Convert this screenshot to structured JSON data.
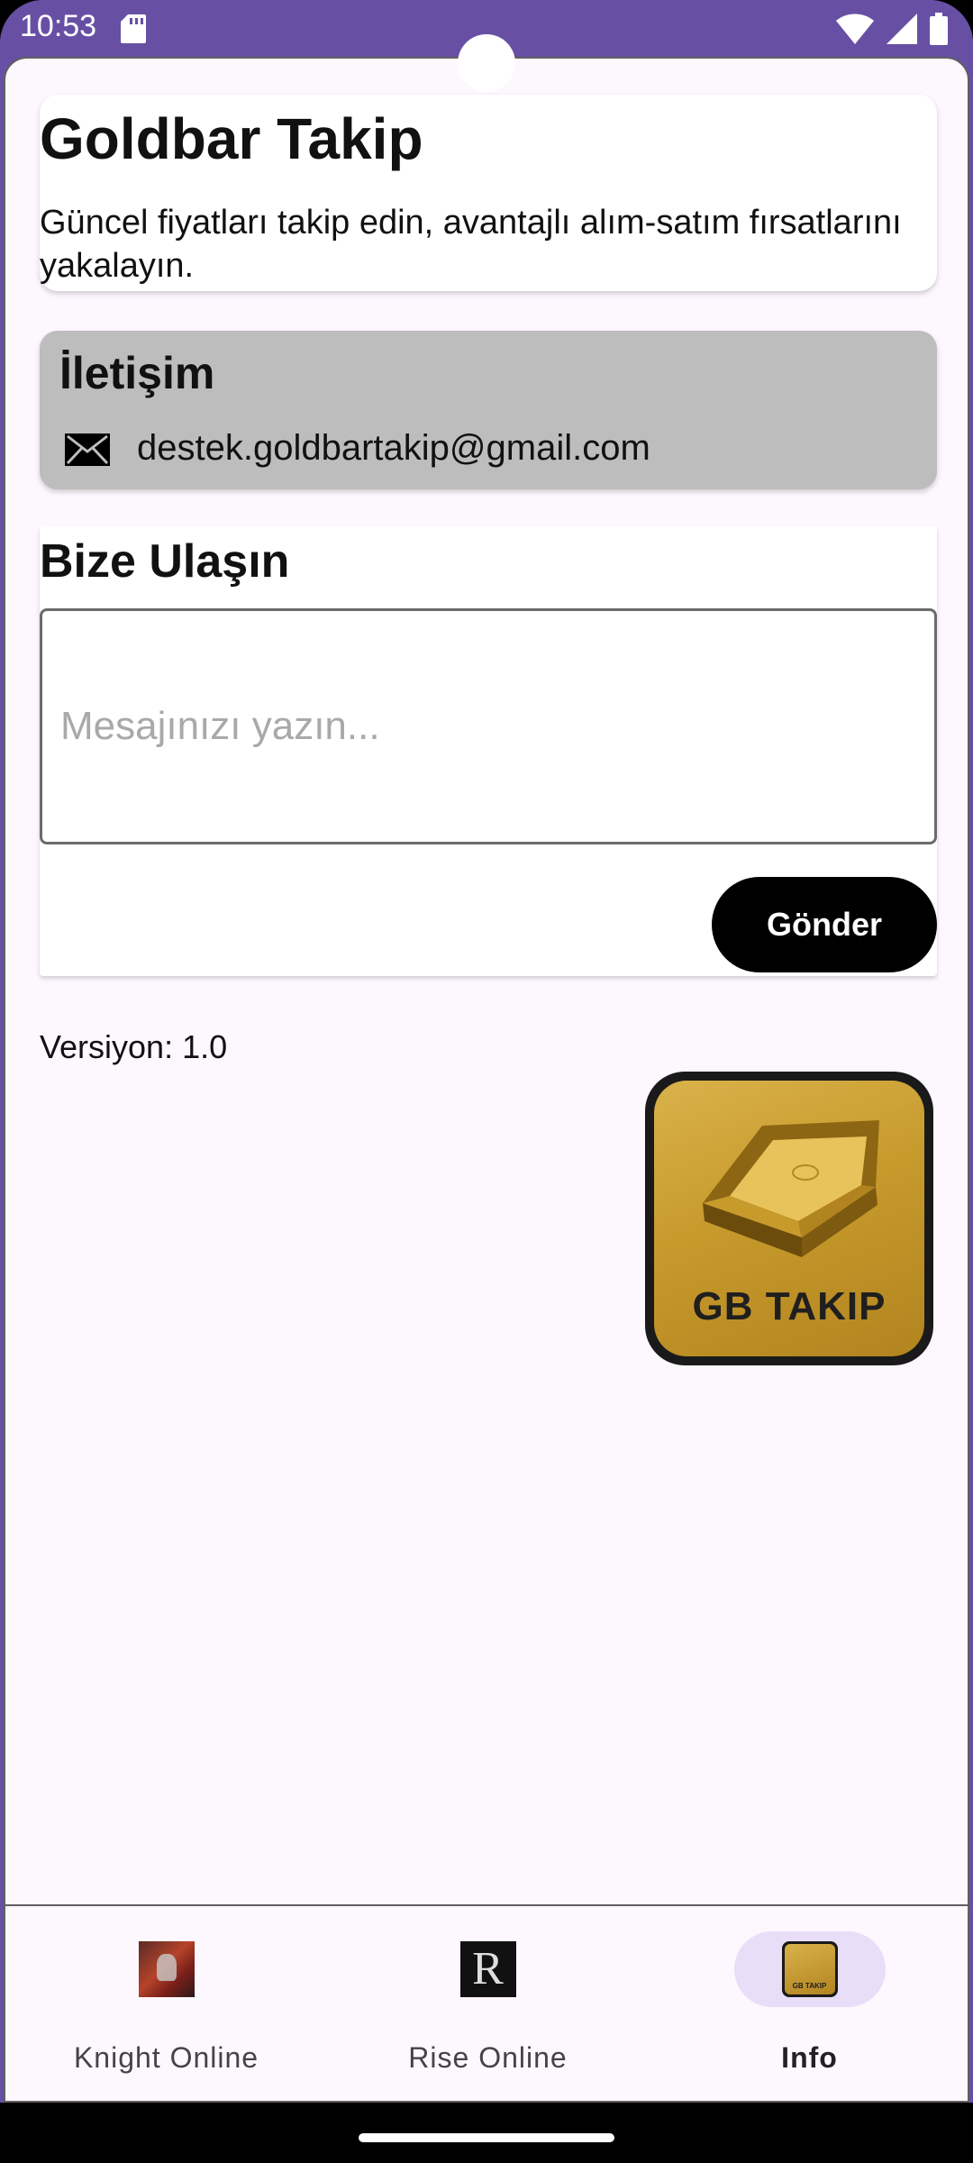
{
  "status_bar": {
    "time": "10:53",
    "icons": [
      "sd-card-icon",
      "wifi-icon",
      "signal-icon",
      "battery-icon"
    ]
  },
  "header": {
    "title": "Goldbar Takip",
    "subtitle": "Güncel fiyatları takip edin, avantajlı alım-satım fırsatlarını yakalayın."
  },
  "contact": {
    "title": "İletişim",
    "icon": "mail-icon",
    "email": "destek.goldbartakip@gmail.com"
  },
  "form": {
    "title": "Bize Ulaşın",
    "message_value": "",
    "message_placeholder": "Mesajınızı yazın...",
    "send_label": "Gönder"
  },
  "version": "Versiyon: 1.0",
  "logo": {
    "text": "GB TAKIP"
  },
  "bottom_nav": {
    "items": [
      {
        "label": "Knight Online",
        "icon": "knight-online-icon",
        "active": false
      },
      {
        "label": "Rise Online",
        "icon": "rise-online-icon",
        "active": false
      },
      {
        "label": "Info",
        "icon": "info-gb-icon",
        "active": true
      }
    ]
  },
  "colors": {
    "status_bar": "#6750A4",
    "background": "#FDF7FE",
    "contact_card": "#BDBDBD",
    "send_button": "#000000",
    "nav_active_indicator": "#E8DEF8"
  }
}
